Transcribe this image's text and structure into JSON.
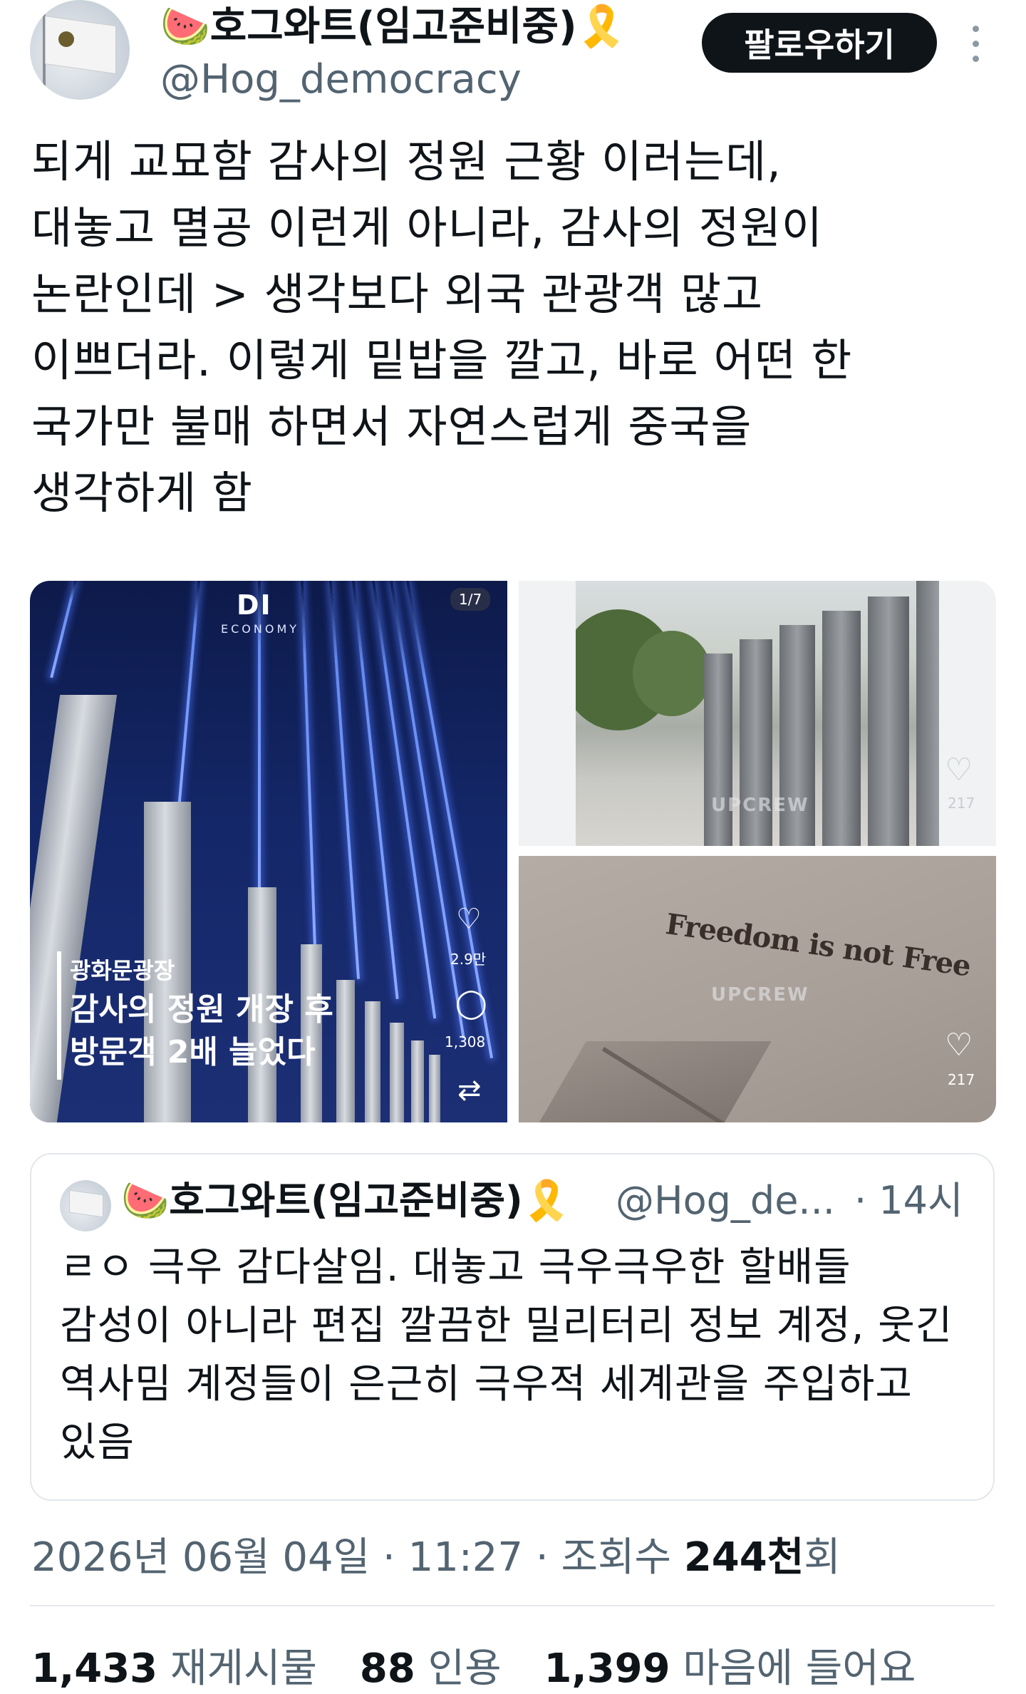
{
  "author": {
    "name": "🍉호그와트(임고준비중)🎗️",
    "handle": "@Hog_democracy",
    "follow_label": "팔로우하기"
  },
  "tweet": {
    "text": "되게 교묘함 감사의 정원 근황 이러는데,\n대놓고 멸공 이런게 아니라, 감사의 정원이\n논란인데 > 생각보다 외국 관광객 많고\n이쁘더라. 이렇게 밑밥을 깔고, 바로 어떤 한\n국가만 불매 하면서 자연스럽게 중국을\n생각하게 함"
  },
  "media": {
    "image1": {
      "logo": "DI",
      "logo_sub": "ECONOMY",
      "page": "1/7",
      "caption_small": "광화문광장",
      "caption_big": "감사의 정원 개장 후\n방문객 2배 늘었다",
      "likes": "2.9만",
      "comments": "1,308"
    },
    "image2": {
      "watermark": "UPCREW",
      "likes": "217"
    },
    "image3": {
      "wall_text": "Freedom is not Free",
      "watermark": "UPCREW",
      "likes": "217"
    }
  },
  "quote": {
    "name": "🍉호그와트(임고준비중)🎗️",
    "handle": "@Hog_de...",
    "time": "· 14시",
    "text": "ㄹㅇ 극우 감다살임. 대놓고 극우극우한 할배들\n감성이 아니라 편집 깔끔한 밀리터리 정보 계정, 웃긴\n역사밈 계정들이 은근히 극우적 세계관을 주입하고\n있음"
  },
  "meta": {
    "date": "2026년 06월 04일",
    "time": "11:27",
    "views_label": "조회수",
    "views": "244천",
    "views_suffix": "회"
  },
  "stats": {
    "retweets": "1,433",
    "retweets_label": "재게시물",
    "quotes": "88",
    "quotes_label": "인용",
    "likes": "1,399",
    "likes_label": "마음에 들어요"
  }
}
